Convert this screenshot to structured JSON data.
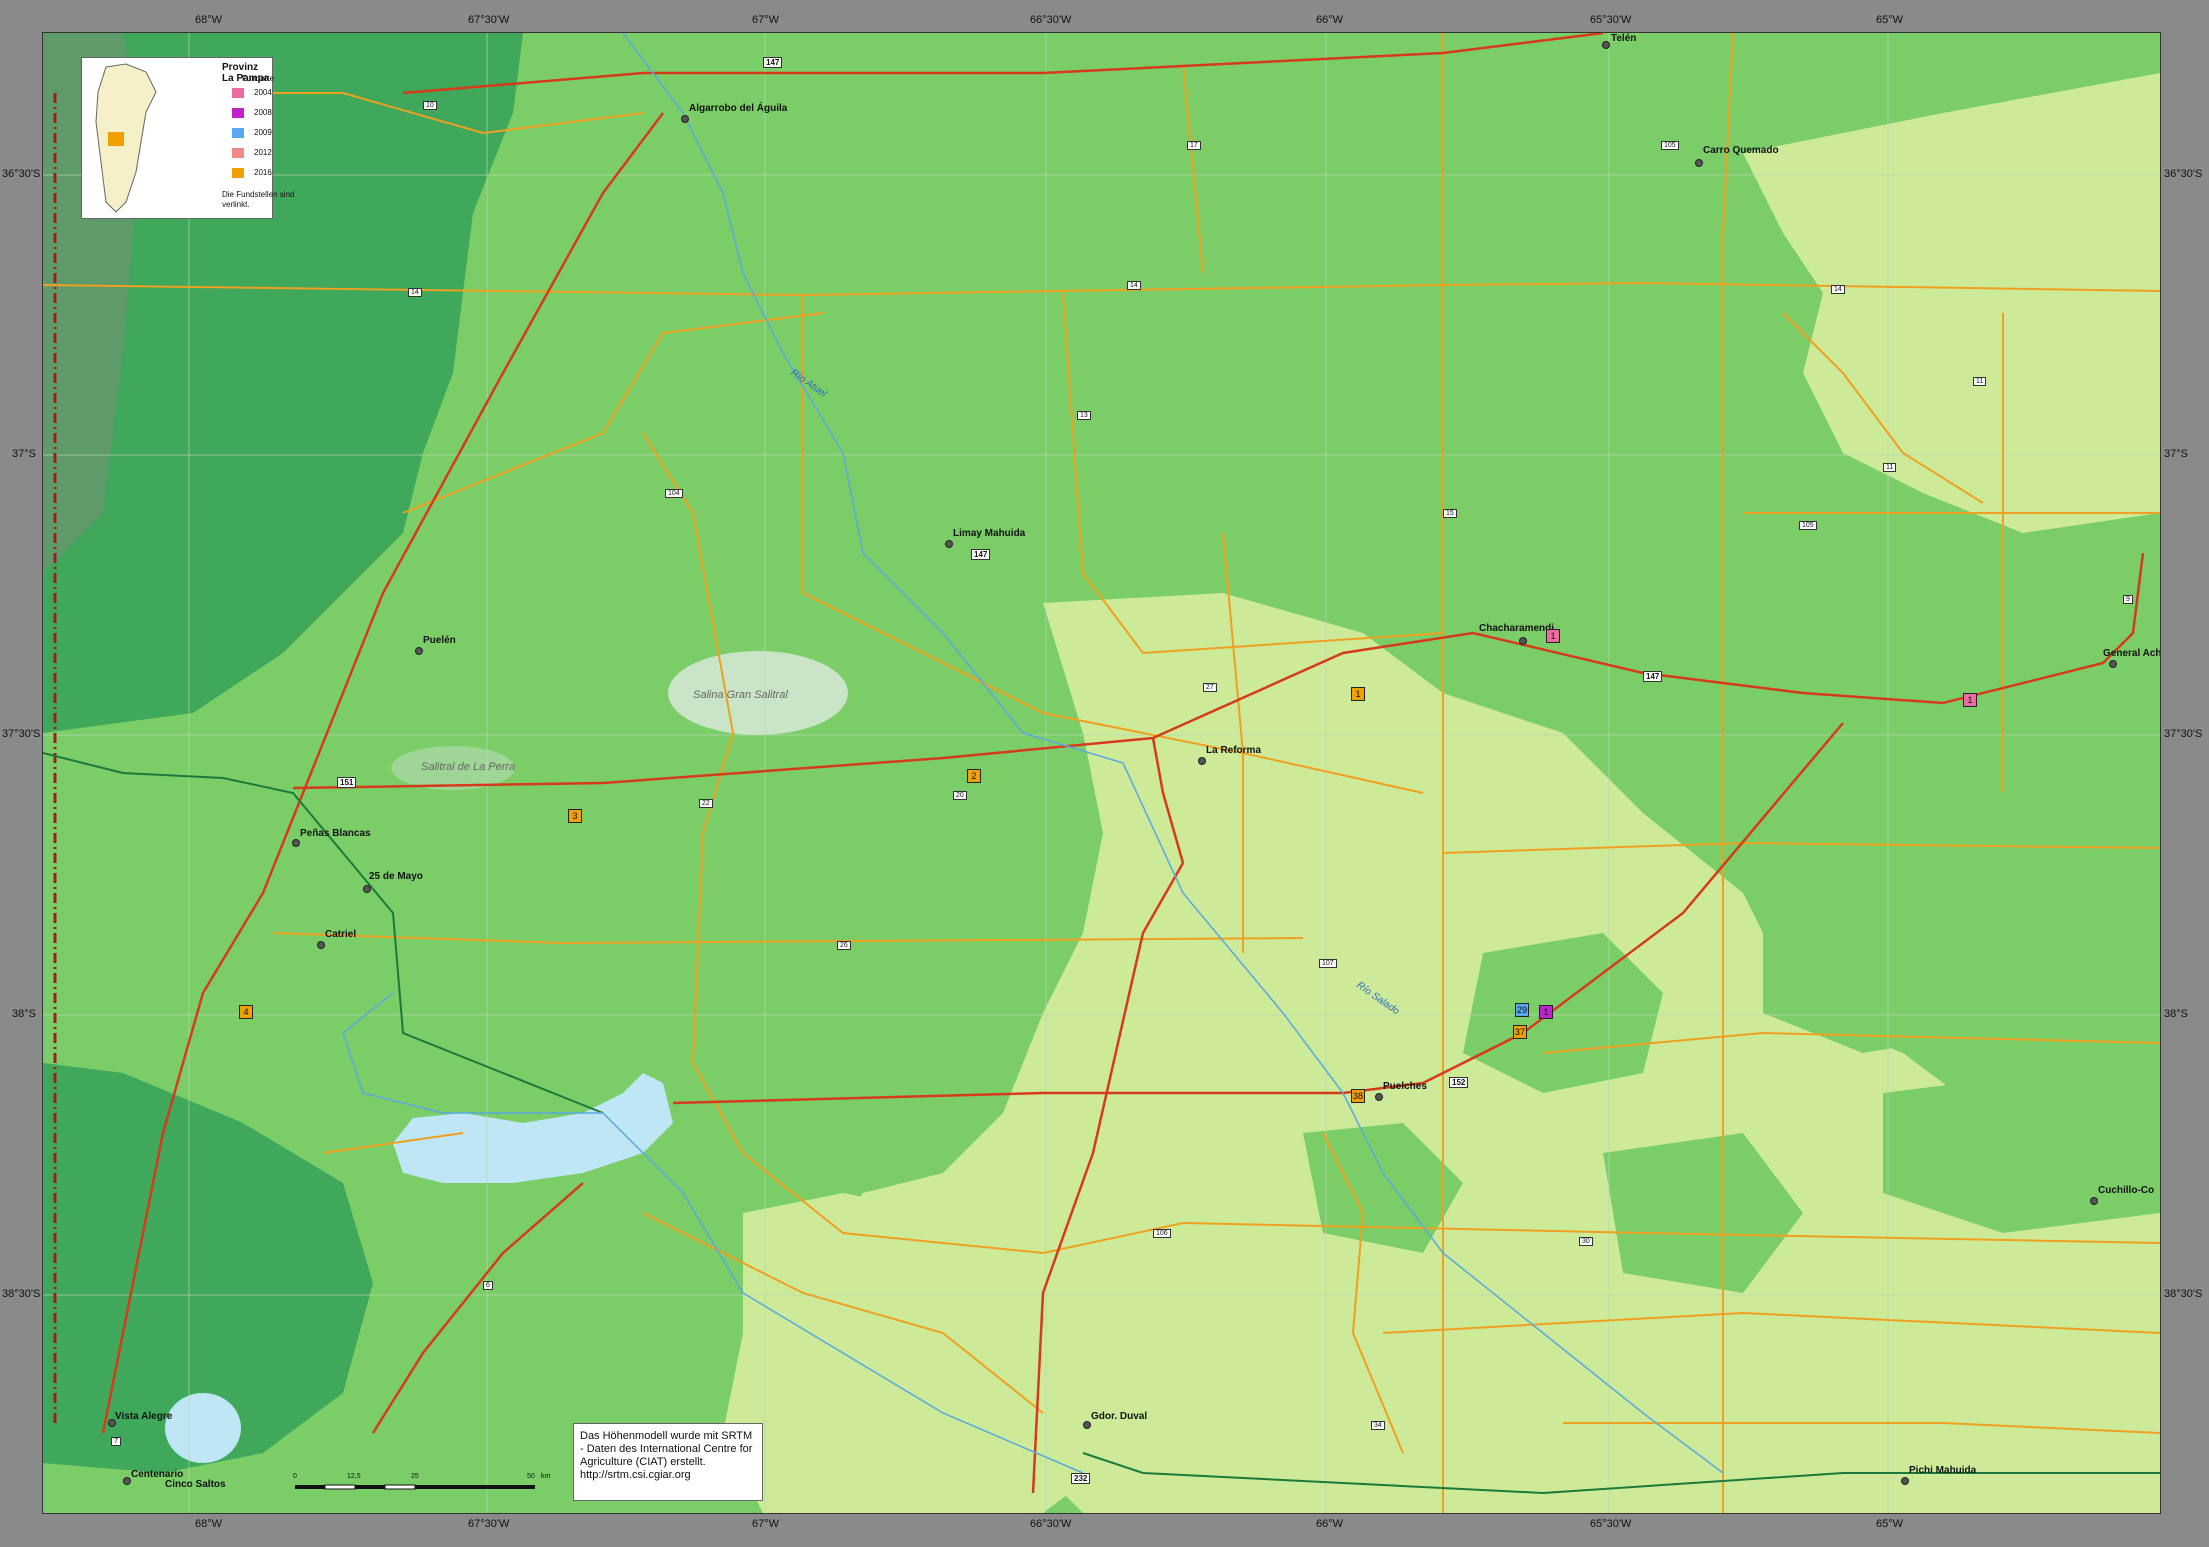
{
  "top_axis": [
    "68°W",
    "67°30'W",
    "67°W",
    "66°30'W",
    "66°W",
    "65°30'W",
    "65°W"
  ],
  "bottom_axis": [
    "68°W",
    "67°30'W",
    "67°W",
    "66°30'W",
    "66°W",
    "65°30'W",
    "65°W"
  ],
  "left_axis": [
    "36°30'S",
    "37°S",
    "37°30'S",
    "38°S",
    "38°30'S"
  ],
  "right_axis": [
    "36°30'S",
    "37°S",
    "37°30'S",
    "38°S",
    "38°30'S"
  ],
  "legend": {
    "title": "Provinz La Pampa",
    "subtitle": "Fundorte",
    "entries": [
      {
        "year": "2004",
        "color": "#f06aa0"
      },
      {
        "year": "2008",
        "color": "#c020d0"
      },
      {
        "year": "2009",
        "color": "#5aa8f0"
      },
      {
        "year": "2012",
        "color": "#f08a8a"
      },
      {
        "year": "2016",
        "color": "#f0a000"
      }
    ],
    "note": "Die Fundstellen sind verlinkt."
  },
  "places": {
    "telen": "Telén",
    "algarrobo": "Algarrobo del Águila",
    "carro_quemado": "Carro Quemado",
    "limay_mahuida": "Limay Mahuida",
    "chacharamendi": "Chacharamendi",
    "general_acha": "General Acha",
    "puelen": "Puelén",
    "la_reforma": "La Reforma",
    "penas_blancas": "Peñas Blancas",
    "veinticinco_mayo": "25 de Mayo",
    "catriel": "Catriel",
    "puelches": "Puelches",
    "cuchillo_co": "Cuchillo-Co",
    "vista_alegre": "Vista Alegre",
    "centenario": "Centenario",
    "cinco_saltos": "Cinco Saltos",
    "gdor_duval": "Gdor. Duval",
    "pichi_mahuida": "Pichi Mahuida"
  },
  "features": {
    "salina_gran_salitral": "Salina Gran Salitral",
    "salitral_la_perra": "Salitral de La Perra",
    "rio_atuel": "Río Atuel",
    "rio_salado": "Río Salado"
  },
  "roads": {
    "r147a": "147",
    "r10": "10",
    "r14": "14",
    "r17": "17",
    "r105a": "105",
    "r104": "104",
    "r147b": "147",
    "r13": "13",
    "r15": "15",
    "r11": "11",
    "r151": "151",
    "r20": "20",
    "r22": "22",
    "r27": "27",
    "r26": "26",
    "r107": "107",
    "r152": "152",
    "r106": "106",
    "r6": "6",
    "r232": "232",
    "r30": "30",
    "r34": "34",
    "r9": "9",
    "r7": "7",
    "r147c": "147"
  },
  "finds": [
    {
      "label": "1",
      "color": "#f06aa0"
    },
    {
      "label": "1",
      "color": "#f0a000"
    },
    {
      "label": "1",
      "color": "#f06aa0"
    },
    {
      "label": "2",
      "color": "#f0a000"
    },
    {
      "label": "3",
      "color": "#f0a000"
    },
    {
      "label": "4",
      "color": "#f0a000"
    },
    {
      "label": "29",
      "color": "#5aa8f0"
    },
    {
      "label": "1",
      "color": "#c020d0"
    },
    {
      "label": "37",
      "color": "#f0a000"
    },
    {
      "label": "38",
      "color": "#f0a000"
    }
  ],
  "credit": "Das Höhenmodell wurde mit SRTM - Daten des International Centre for Agriculture (CIAT) erstellt. http://srtm.csi.cgiar.org",
  "scale": {
    "labels": [
      "0",
      "12,5",
      "25",
      "50"
    ],
    "unit": "km"
  },
  "colors": {
    "highland": "#3fa85a",
    "midland": "#7bcd68",
    "lowland": "#cdea98",
    "water": "#bfe6f5",
    "national_route": "#d63a1a",
    "provincial_route": "#f0a020",
    "border": "#9a2020",
    "railway": "#1a7a3a"
  }
}
